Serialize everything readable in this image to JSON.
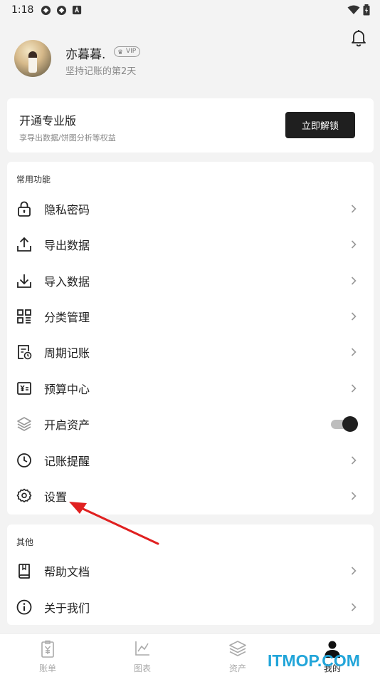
{
  "status_bar": {
    "time": "1:18"
  },
  "profile": {
    "nickname": "亦暮暮.",
    "vip_label": "VIP",
    "subtitle": "坚持记账的第2天"
  },
  "pro_card": {
    "title": "开通专业版",
    "description": "享导出数据/饼图分析等权益",
    "unlock_label": "立即解锁"
  },
  "common_functions": {
    "title": "常用功能",
    "items": [
      {
        "label": "隐私密码",
        "icon": "lock-icon"
      },
      {
        "label": "导出数据",
        "icon": "upload-icon"
      },
      {
        "label": "导入数据",
        "icon": "download-icon"
      },
      {
        "label": "分类管理",
        "icon": "category-grid-icon"
      },
      {
        "label": "周期记账",
        "icon": "recurring-bill-icon"
      },
      {
        "label": "预算中心",
        "icon": "budget-icon"
      },
      {
        "label": "开启资产",
        "icon": "layers-icon",
        "toggle_on": true
      },
      {
        "label": "记账提醒",
        "icon": "clock-icon"
      },
      {
        "label": "设置",
        "icon": "gear-icon"
      }
    ]
  },
  "other": {
    "title": "其他",
    "items": [
      {
        "label": "帮助文档",
        "icon": "book-icon"
      },
      {
        "label": "关于我们",
        "icon": "info-icon"
      }
    ]
  },
  "tabbar": {
    "tabs": [
      {
        "label": "账单",
        "icon": "bill-icon"
      },
      {
        "label": "图表",
        "icon": "chart-icon"
      },
      {
        "label": "资产",
        "icon": "layers-icon"
      },
      {
        "label": "我的",
        "icon": "person-icon",
        "active": true
      }
    ]
  },
  "watermark": "ITMOP.COM",
  "colors": {
    "background": "#f3f3f3",
    "card": "#ffffff",
    "accent_dark": "#1f1f1f",
    "annotation_arrow": "#e02020",
    "watermark": "#22a5d9"
  }
}
